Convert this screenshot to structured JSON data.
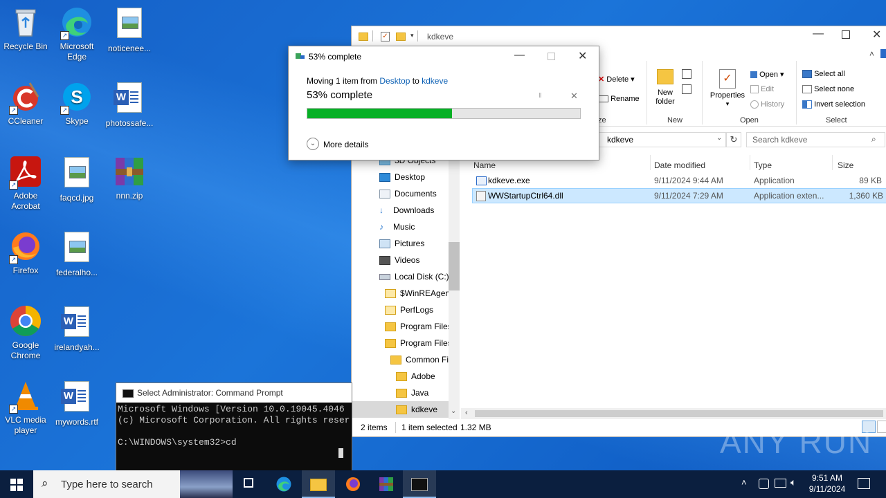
{
  "desktop": {
    "icons": [
      {
        "label": "Recycle Bin"
      },
      {
        "label": "Microsoft Edge"
      },
      {
        "label": "noticenee..."
      },
      {
        "label": "CCleaner"
      },
      {
        "label": "Skype"
      },
      {
        "label": "photossafe..."
      },
      {
        "label": "Adobe Acrobat"
      },
      {
        "label": "faqcd.jpg"
      },
      {
        "label": "nnn.zip"
      },
      {
        "label": "Firefox"
      },
      {
        "label": "federalho..."
      },
      {
        "label": "Google Chrome"
      },
      {
        "label": "irelandyah..."
      },
      {
        "label": "VLC media player"
      },
      {
        "label": "mywords.rtf"
      }
    ]
  },
  "progress_dialog": {
    "title": "53% complete",
    "moving_prefix": "Moving 1 item from",
    "source": "Desktop",
    "to_word": "to",
    "destination": "kdkeve",
    "status": "53% complete",
    "percent": 53,
    "more_details": "More details",
    "pause_glyph": "II",
    "cancel_glyph": "✕"
  },
  "explorer": {
    "title": "kdkeve",
    "ribbon": {
      "delete": "Delete",
      "rename": "Rename",
      "new_folder": "New folder",
      "properties": "Properties",
      "open": "Open",
      "edit": "Edit",
      "history": "History",
      "select_all": "Select all",
      "select_none": "Select none",
      "invert_selection": "Invert selection",
      "groups": {
        "organize_tail": "ze",
        "new": "New",
        "open": "Open",
        "select": "Select"
      }
    },
    "address": "kdkeve",
    "search_placeholder": "Search kdkeve",
    "nav_items": [
      "3D Objects",
      "Desktop",
      "Documents",
      "Downloads",
      "Music",
      "Pictures",
      "Videos",
      "Local Disk (C:)",
      "$WinREAgent",
      "PerfLogs",
      "Program Files",
      "Program Files",
      "Common Fi",
      "Adobe",
      "Java",
      "kdkeve"
    ],
    "columns": {
      "name": "Name",
      "date": "Date modified",
      "type": "Type",
      "size": "Size"
    },
    "files": [
      {
        "name": "kdkeve.exe",
        "date": "9/11/2024 9:44 AM",
        "type": "Application",
        "size": "89 KB"
      },
      {
        "name": "WWStartupCtrl64.dll",
        "date": "9/11/2024 7:29 AM",
        "type": "Application exten...",
        "size": "1,360 KB"
      }
    ],
    "status": {
      "count": "2 items",
      "selected": "1 item selected",
      "size": "1.32 MB"
    }
  },
  "cmd": {
    "title": "Select Administrator: Command Prompt",
    "line1": "Microsoft Windows [Version 10.0.19045.4046",
    "line2": "(c) Microsoft Corporation. All rights reser",
    "line3": "",
    "line4": "C:\\WINDOWS\\system32>cd"
  },
  "taskbar": {
    "search_placeholder": "Type here to search",
    "time": "9:51 AM",
    "date": "9/11/2024"
  },
  "watermark": "ANY RUN"
}
